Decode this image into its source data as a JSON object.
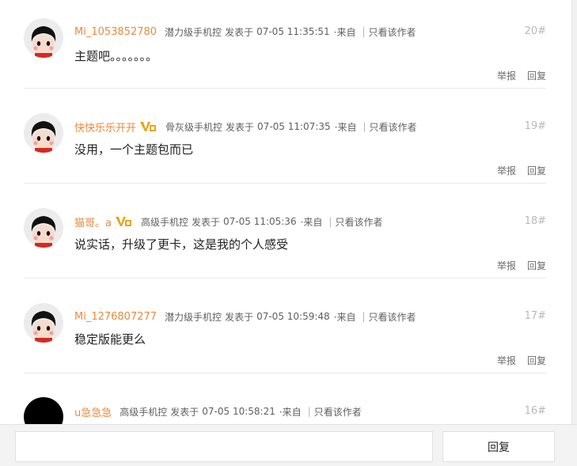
{
  "posts": [
    {
      "username": "Mi_1053852780",
      "vip": false,
      "level": "潜力级手机控",
      "posted_label": "发表于",
      "date": "07-05 11:35:51",
      "from": "·来自",
      "only_author": "只看该作者",
      "floor": "20#",
      "content": "主题吧。。。。。。。",
      "report": "举报",
      "reply": "回复"
    },
    {
      "username": "快快乐乐开开",
      "vip": true,
      "level": "骨灰级手机控",
      "posted_label": "发表于",
      "date": "07-05 11:07:35",
      "from": "·来自",
      "only_author": "只看该作者",
      "floor": "19#",
      "content": "没用，一个主题包而已",
      "report": "举报",
      "reply": "回复"
    },
    {
      "username": "猫哥。a",
      "vip": true,
      "level": "高级手机控",
      "posted_label": "发表于",
      "date": "07-05 11:05:36",
      "from": "·来自",
      "only_author": "只看该作者",
      "floor": "18#",
      "content": "说实话，升级了更卡，这是我的个人感受",
      "report": "举报",
      "reply": "回复"
    },
    {
      "username": "Mi_1276807277",
      "vip": false,
      "level": "潜力级手机控",
      "posted_label": "发表于",
      "date": "07-05 10:59:48",
      "from": "·来自",
      "only_author": "只看该作者",
      "floor": "17#",
      "content": "稳定版能更么",
      "report": "举报",
      "reply": "回复"
    },
    {
      "username": "u急急急",
      "vip": false,
      "level": "高级手机控",
      "posted_label": "发表于",
      "date": "07-05 10:58:21",
      "from": "·来自",
      "only_author": "只看该作者",
      "floor": "16#",
      "content": "",
      "report": "",
      "reply": ""
    }
  ],
  "reply_bar": {
    "input_value": "",
    "button_label": "回复"
  },
  "colors": {
    "username": "#ea8a3c",
    "vip_badge": "#e8a316",
    "meta": "#5f5f5f",
    "floor": "#b9b9b9",
    "divider": "#e9e9e9"
  },
  "icons": {
    "avatar": "cartoon-avatar-icon",
    "vip": "vip-badge-icon"
  }
}
